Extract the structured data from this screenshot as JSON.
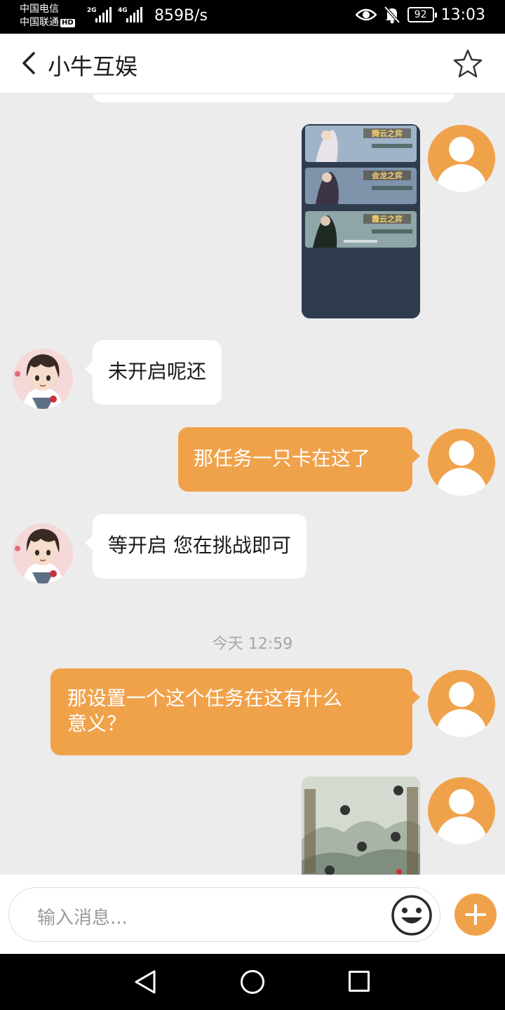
{
  "status_bar": {
    "carrier_1": "中国电信",
    "carrier_2": "中国联通",
    "hd_badge": "HD",
    "net_1": "2G",
    "net_2": "4G",
    "net_speed": "859B/s",
    "battery": "92",
    "time": "13:03"
  },
  "header": {
    "title": "小牛互娱",
    "back_icon": "chevron-left-icon",
    "favorite_icon": "star-outline-icon"
  },
  "messages": [
    {
      "type": "image",
      "side": "out",
      "image_text": [
        "腾云之弈",
        "会龙之弈",
        "霞云之弈"
      ]
    },
    {
      "type": "text",
      "side": "in",
      "text": "未开启呢还"
    },
    {
      "type": "text",
      "side": "out",
      "text": "那任务一只卡在这了"
    },
    {
      "type": "text",
      "side": "in",
      "text": "等开启 您在挑战即可"
    },
    {
      "type": "timestamp",
      "text": "今天 12:59"
    },
    {
      "type": "text",
      "side": "out",
      "text_lines": [
        "那设置一个这个任务在这有什么",
        "意义？"
      ]
    },
    {
      "type": "image",
      "side": "out"
    }
  ],
  "input_bar": {
    "placeholder": "输入消息...",
    "emoji_icon": "smiley-icon",
    "add_icon": "plus-icon"
  },
  "colors": {
    "accent": "#f0a24b",
    "chat_bg": "#ececec",
    "incoming_bubble": "#ffffff",
    "timestamp": "#a6a6a6"
  }
}
